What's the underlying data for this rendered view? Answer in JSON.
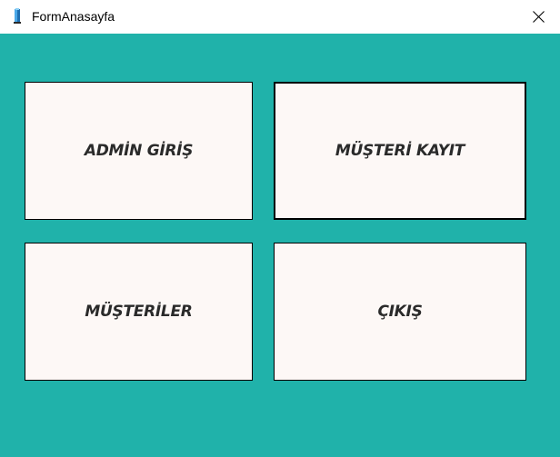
{
  "window": {
    "title": "FormAnasayfa",
    "app_icon": "app-icon",
    "close_icon": "close-icon",
    "background": "#20b2aa"
  },
  "buttons": [
    {
      "label": "ADMİN GİRİŞ"
    },
    {
      "label": "MÜŞTERİ KAYIT"
    },
    {
      "label": "MÜŞTERİLER"
    },
    {
      "label": "ÇIKIŞ"
    }
  ]
}
